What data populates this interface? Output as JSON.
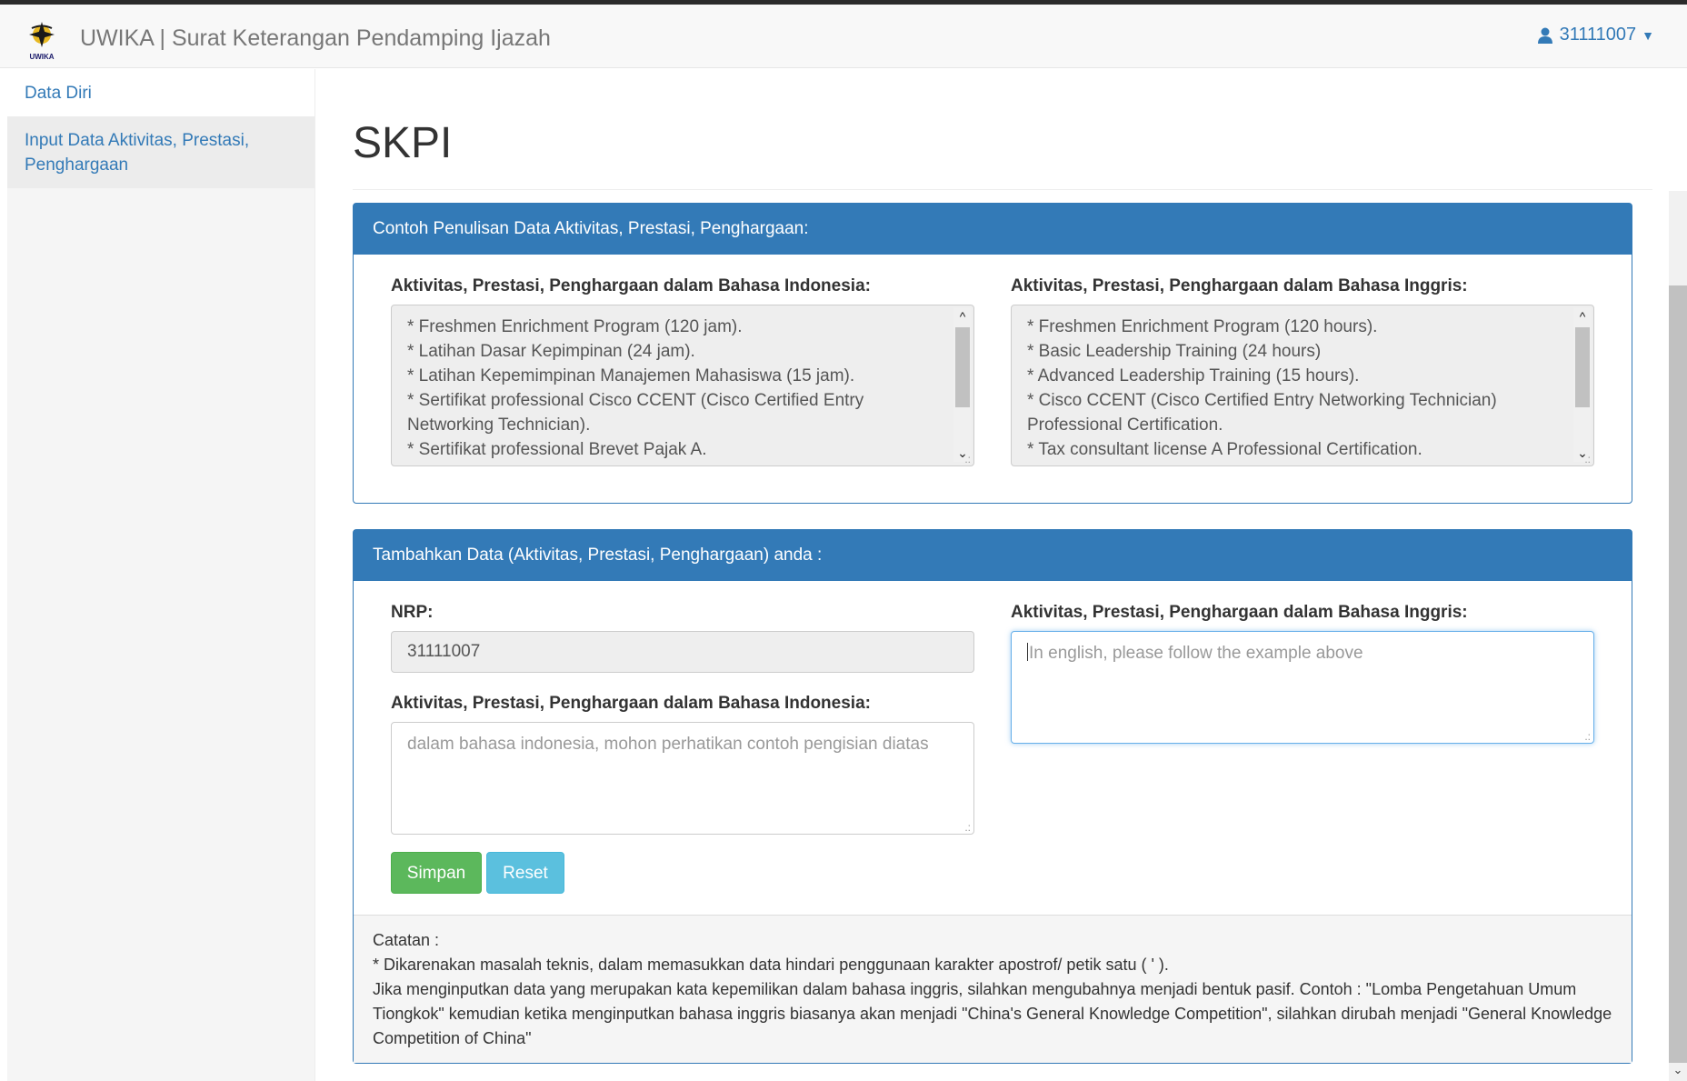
{
  "navbar": {
    "logo_label": "UWIKA",
    "title": "UWIKA | Surat Keterangan Pendamping Ijazah",
    "user": "31111007",
    "user_icon": "user-icon",
    "caret_icon": "caret-down-icon"
  },
  "sidebar": {
    "items": [
      {
        "label": "Data Diri"
      },
      {
        "label": "Input Data Aktivitas, Prestasi, Penghargaan"
      }
    ]
  },
  "main": {
    "title": "SKPI",
    "example_panel": {
      "heading": "Contoh Penulisan Data Aktivitas, Prestasi, Penghargaan:",
      "left_label": "Aktivitas, Prestasi, Penghargaan dalam Bahasa Indonesia:",
      "left_lines": [
        "* Freshmen Enrichment Program (120 jam).",
        "* Latihan Dasar Kepimpinan (24 jam).",
        "* Latihan Kepemimpinan Manajemen Mahasiswa (15 jam).",
        "* Sertifikat professional Cisco CCENT (Cisco Certified Entry",
        "Networking Technician).",
        "* Sertifikat professional Brevet Pajak A."
      ],
      "right_label": "Aktivitas, Prestasi, Penghargaan dalam Bahasa Inggris:",
      "right_lines": [
        "* Freshmen Enrichment Program (120 hours).",
        "* Basic Leadership Training (24 hours)",
        "* Advanced Leadership Training (15 hours).",
        "* Cisco CCENT (Cisco Certified Entry Networking Technician)",
        "Professional Certification.",
        "* Tax consultant license A Professional Certification."
      ]
    },
    "form_panel": {
      "heading": "Tambahkan Data (Aktivitas, Prestasi, Penghargaan) anda :",
      "nrp_label": "NRP:",
      "nrp_value": "31111007",
      "indo_label": "Aktivitas, Prestasi, Penghargaan dalam Bahasa Indonesia:",
      "indo_placeholder": "dalam bahasa indonesia, mohon perhatikan contoh pengisian diatas",
      "eng_label": "Aktivitas, Prestasi, Penghargaan dalam Bahasa Inggris:",
      "eng_placeholder": "In english, please follow the example above",
      "save_label": "Simpan",
      "reset_label": "Reset",
      "notes": {
        "title": "Catatan :",
        "line1": "* Dikarenakan masalah teknis, dalam memasukkan data hindari penggunaan karakter apostrof/ petik satu ( ' ).",
        "line2": "Jika menginputkan data yang merupakan kata kepemilikan dalam bahasa inggris, silahkan mengubahnya menjadi bentuk pasif. Contoh : \"Lomba Pengetahuan Umum Tiongkok\" kemudian ketika menginputkan bahasa inggris biasanya akan menjadi \"China's General Knowledge Competition\", silahkan dirubah menjadi \"General Knowledge Competition of China\""
      }
    }
  },
  "colors": {
    "primary": "#337ab7",
    "success": "#5cb85c",
    "info": "#5bc0de"
  }
}
